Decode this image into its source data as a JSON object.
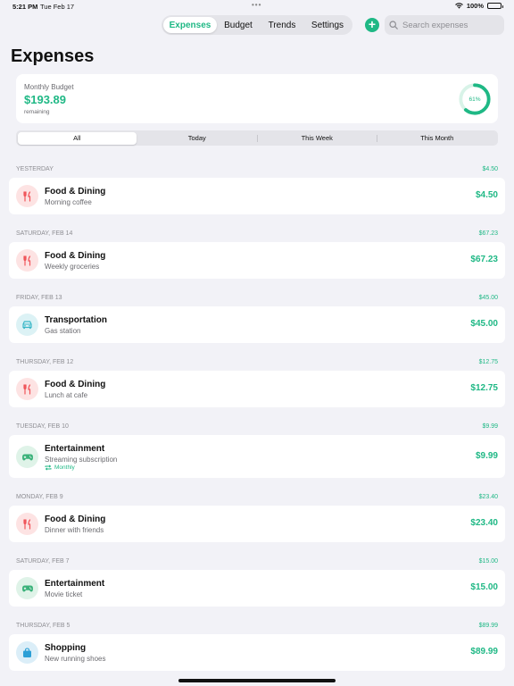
{
  "status": {
    "time": "5:21 PM",
    "date": "Tue Feb 17",
    "battery": "100%"
  },
  "nav": {
    "tabs": [
      {
        "label": "Expenses",
        "active": true
      },
      {
        "label": "Budget",
        "active": false
      },
      {
        "label": "Trends",
        "active": false
      },
      {
        "label": "Settings",
        "active": false
      }
    ],
    "add_icon": "plus-icon",
    "search_placeholder": "Search expenses"
  },
  "page_title": "Expenses",
  "budget": {
    "label": "Monthly Budget",
    "amount": "$193.89",
    "sub": "remaining",
    "progress_label": "61%",
    "progress": 0.61
  },
  "filters": [
    {
      "label": "All",
      "active": true
    },
    {
      "label": "Today",
      "active": false
    },
    {
      "label": "This Week",
      "active": false
    },
    {
      "label": "This Month",
      "active": false
    }
  ],
  "colors": {
    "accent": "#1fb885",
    "food": "#f0555a",
    "transport": "#39b7c7",
    "entertainment": "#3bb27a",
    "shopping": "#2b9fd6"
  },
  "sections": [
    {
      "date": "YESTERDAY",
      "total": "$4.50",
      "items": [
        {
          "icon": "fork-knife-icon",
          "category": "Food & Dining",
          "desc": "Morning coffee",
          "amount": "$4.50"
        }
      ]
    },
    {
      "date": "SATURDAY, FEB 14",
      "total": "$67.23",
      "items": [
        {
          "icon": "fork-knife-icon",
          "category": "Food & Dining",
          "desc": "Weekly groceries",
          "amount": "$67.23"
        }
      ]
    },
    {
      "date": "FRIDAY, FEB 13",
      "total": "$45.00",
      "items": [
        {
          "icon": "car-icon",
          "category": "Transportation",
          "desc": "Gas station",
          "amount": "$45.00"
        }
      ]
    },
    {
      "date": "THURSDAY, FEB 12",
      "total": "$12.75",
      "items": [
        {
          "icon": "fork-knife-icon",
          "category": "Food & Dining",
          "desc": "Lunch at cafe",
          "amount": "$12.75"
        }
      ]
    },
    {
      "date": "TUESDAY, FEB 10",
      "total": "$9.99",
      "items": [
        {
          "icon": "gamepad-icon",
          "category": "Entertainment",
          "desc": "Streaming subscription",
          "recurring": "Monthly",
          "amount": "$9.99"
        }
      ]
    },
    {
      "date": "MONDAY, FEB 9",
      "total": "$23.40",
      "items": [
        {
          "icon": "fork-knife-icon",
          "category": "Food & Dining",
          "desc": "Dinner with friends",
          "amount": "$23.40"
        }
      ]
    },
    {
      "date": "SATURDAY, FEB 7",
      "total": "$15.00",
      "items": [
        {
          "icon": "gamepad-icon",
          "category": "Entertainment",
          "desc": "Movie ticket",
          "amount": "$15.00"
        }
      ]
    },
    {
      "date": "THURSDAY, FEB 5",
      "total": "$89.99",
      "items": [
        {
          "icon": "bag-icon",
          "category": "Shopping",
          "desc": "New running shoes",
          "amount": "$89.99"
        }
      ]
    }
  ]
}
